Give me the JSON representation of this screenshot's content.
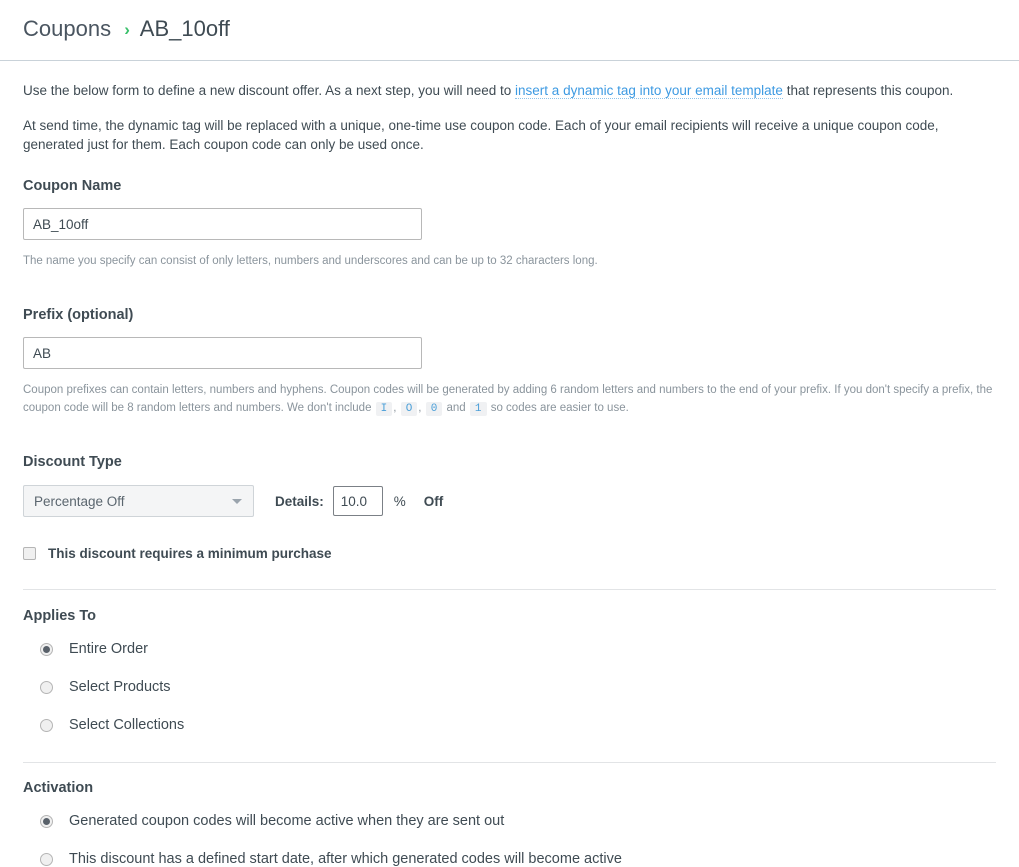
{
  "header": {
    "breadcrumb_root": "Coupons",
    "breadcrumb_separator": "›",
    "breadcrumb_current": "AB_10off"
  },
  "intro": {
    "paragraph1_before": "Use the below form to define a new discount offer. As a next step, you will need to ",
    "paragraph1_link": "insert a dynamic tag into your email template",
    "paragraph1_after": " that represents this coupon.",
    "paragraph2": "At send time, the dynamic tag will be replaced with a unique, one-time use coupon code. Each of your email recipients will receive a unique coupon code, generated just for them. Each coupon code can only be used once."
  },
  "coupon_name": {
    "title": "Coupon Name",
    "value": "AB_10off",
    "placeholder": "",
    "helper": "The name you specify can consist of only letters, numbers and underscores and can be up to 32 characters long."
  },
  "prefix": {
    "title": "Prefix (optional)",
    "value": "AB",
    "placeholder": "",
    "helper_part1": "Coupon prefixes can contain letters, numbers and hyphens. Coupon codes will be generated by adding 6 random letters and numbers to the end of your prefix. If you don't specify a prefix, the coupon code will be 8 random letters and numbers. We don't include ",
    "excluded_chars": [
      "I",
      "O",
      "0",
      "1"
    ],
    "helper_sep1": ",",
    "helper_sep2": ",",
    "helper_and": "and",
    "helper_part2": "so codes are easier to use."
  },
  "discount_type": {
    "title": "Discount Type",
    "selected": "Percentage Off",
    "options": [
      "Percentage Off"
    ],
    "details_label": "Details:",
    "details_value": "10.0",
    "unit_symbol": "%",
    "unit_word": "Off",
    "minimum_purchase_label": "This discount requires a minimum purchase",
    "minimum_purchase_checked": false
  },
  "applies_to": {
    "title": "Applies To",
    "options": [
      {
        "label": "Entire Order",
        "checked": true
      },
      {
        "label": "Select Products",
        "checked": false
      },
      {
        "label": "Select Collections",
        "checked": false
      }
    ]
  },
  "activation": {
    "title": "Activation",
    "options": [
      {
        "label": "Generated coupon codes will become active when they are sent out",
        "checked": true
      },
      {
        "label": "This discount has a defined start date, after which generated codes will become active",
        "checked": false
      }
    ]
  },
  "colors": {
    "accent_green": "#3ac06b",
    "link_blue": "#3d9ae2",
    "text": "#3f4b53",
    "helper_text": "#8a949c",
    "border": "#c9d2d9"
  }
}
